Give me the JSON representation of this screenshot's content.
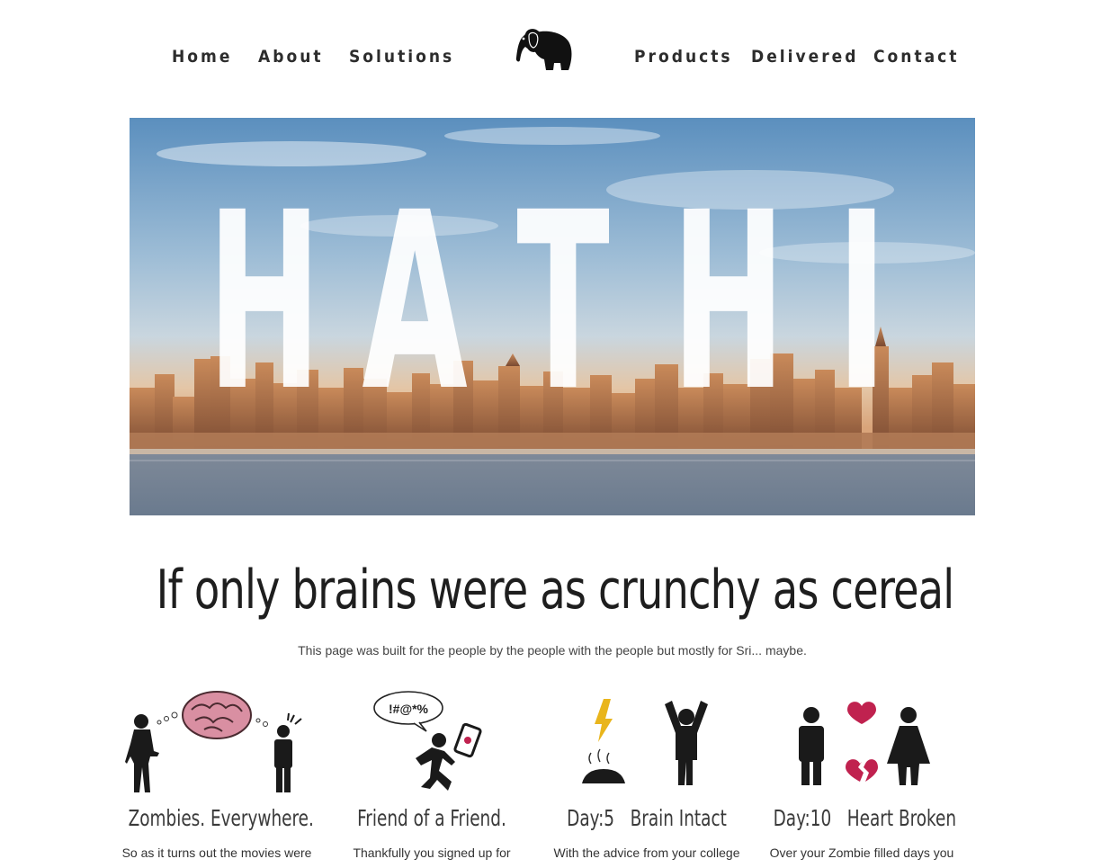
{
  "nav": {
    "home": "Home",
    "about": "About",
    "solutions": "Solutions",
    "products": "Products",
    "delivered": "Delivered",
    "contact": "Contact",
    "logo_icon": "elephant-icon"
  },
  "hero": {
    "letters": [
      "H",
      "A",
      "T",
      "H",
      "I"
    ]
  },
  "headline": "If only brains were as crunchy as cereal",
  "subline": "This page was built for the people by the people with the people but mostly for Sri... maybe.",
  "features": [
    {
      "title": "Zombies. Everywhere.",
      "text": "So as it turns out the movies were",
      "icon": "zombie-brain-person-icon"
    },
    {
      "title": "Friend of a Friend.",
      "text": "Thankfully you signed up for",
      "icon": "running-man-phone-icon",
      "bubble": "!#@*%"
    },
    {
      "title": "Day:5   Brain Intact",
      "text": "With the advice from your college",
      "icon": "lightning-cheering-person-icon"
    },
    {
      "title": "Day:10   Heart Broken",
      "text": "Over your Zombie filled days you",
      "icon": "broken-heart-couple-icon"
    }
  ],
  "colors": {
    "heart": "#c0224f",
    "bolt": "#e9b51c",
    "brain": "#d89aa6",
    "text_dark": "#2d2d2d"
  }
}
